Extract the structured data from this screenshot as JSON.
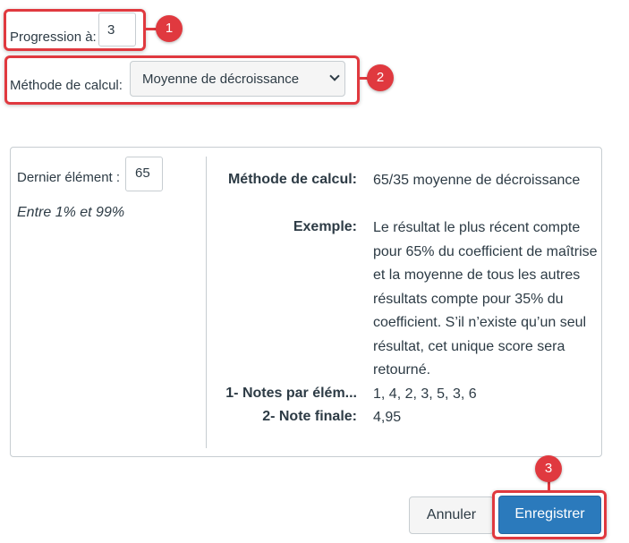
{
  "progression": {
    "label": "Progression à:",
    "value": "3"
  },
  "calculation": {
    "label": "Méthode de calcul:",
    "selected": "Moyenne de décroissance"
  },
  "panel": {
    "last_item_label": "Dernier élément :",
    "last_item_value": "65",
    "range_note": "Entre 1% et 99%",
    "details": [
      {
        "label": "Méthode de calcul:",
        "value": "65/35 moyenne de décroissance"
      },
      {
        "label": "Exemple:",
        "value": "Le résultat le plus récent compte pour 65% du coefficient de maîtrise et la moyenne de tous les autres résultats compte pour 35% du coefficient. S’il n’existe qu’un seul résultat, cet unique score sera retourné."
      },
      {
        "label": "1- Notes par élém...",
        "value": "1, 4, 2, 3, 5, 3, 6"
      },
      {
        "label": "2- Note finale:",
        "value": "4,95"
      }
    ]
  },
  "buttons": {
    "cancel": "Annuler",
    "save": "Enregistrer"
  },
  "markers": [
    "1",
    "2",
    "3"
  ],
  "colors": {
    "highlight": "#e0393f",
    "primary": "#2b7abc"
  }
}
